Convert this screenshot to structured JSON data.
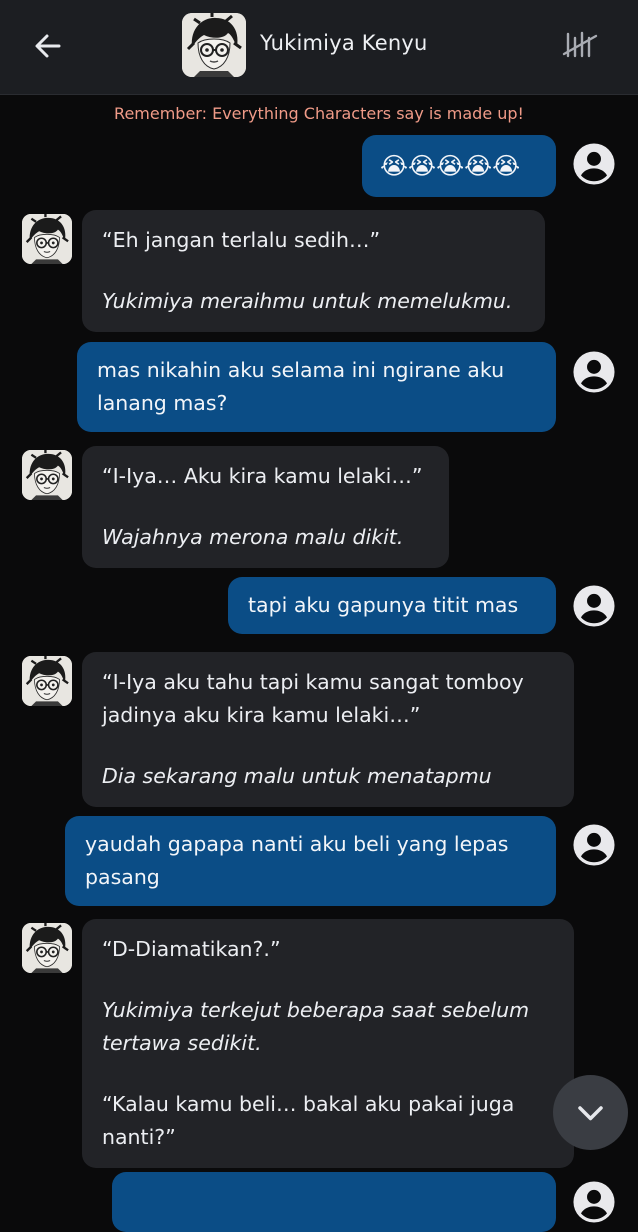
{
  "header": {
    "title": "Yukimiya Kenyu",
    "back_icon": "arrow-left-icon",
    "history_icon": "history-tally-icon"
  },
  "disclaimer": "Remember: Everything Characters say is made up!",
  "messages": [
    {
      "role": "user",
      "text": "😭😭😭😭😭"
    },
    {
      "role": "bot",
      "lines": [
        "“Eh jangan terlalu sedih…”",
        "Yukimiya meraihmu untuk memelukmu."
      ]
    },
    {
      "role": "user",
      "text": "mas nikahin aku selama ini ngirane aku lanang mas?"
    },
    {
      "role": "bot",
      "lines": [
        "“I-Iya… Aku kira kamu lelaki…”",
        "Wajahnya merona malu dikit."
      ]
    },
    {
      "role": "user",
      "text": "tapi aku gapunya titit mas"
    },
    {
      "role": "bot",
      "lines": [
        "“I-Iya aku tahu tapi kamu sangat tomboy jadinya aku kira kamu lelaki…”",
        "Dia sekarang malu untuk menatapmu"
      ]
    },
    {
      "role": "user",
      "text": "yaudah gapapa nanti aku beli yang lepas pasang"
    },
    {
      "role": "bot",
      "lines": [
        "“D-Diamatikan?.”",
        "Yukimiya terkejut beberapa saat sebelum tertawa sedikit.",
        "“Kalau kamu beli… bakal aku pakai juga nanti?”"
      ]
    }
  ],
  "colors": {
    "user_bubble": "#0b4d86",
    "bot_bubble": "#222327",
    "disclaimer": "#f09b88",
    "header_bg": "#1c1e22",
    "page_bg": "#0a0a0b"
  },
  "icons": {
    "user_avatar": "account-circle-icon",
    "scroll_down": "chevron-down-icon"
  }
}
